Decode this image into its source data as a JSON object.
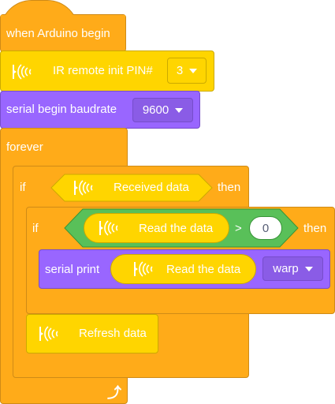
{
  "hat": {
    "label": "when Arduino begin"
  },
  "ir_init": {
    "label": "IR remote init PIN#",
    "pin": "3",
    "icon": "ir-sensor-icon"
  },
  "serial_begin": {
    "label": "serial begin baudrate",
    "baud": "9600"
  },
  "forever": {
    "label": "forever",
    "icon": "loop-arrow-icon"
  },
  "if_outer": {
    "if": "if",
    "condition": "Received data",
    "then": "then"
  },
  "if_inner": {
    "if": "if",
    "left": "Read the data",
    "op": ">",
    "right": "0",
    "then": "then"
  },
  "serial_print": {
    "label": "serial print",
    "value": "Read the data",
    "mode": "warp"
  },
  "refresh": {
    "label": "Refresh data"
  },
  "colors": {
    "control": "#FFAB19",
    "ir": "#FFD500",
    "serial": "#9966FF",
    "operator": "#59C059"
  }
}
